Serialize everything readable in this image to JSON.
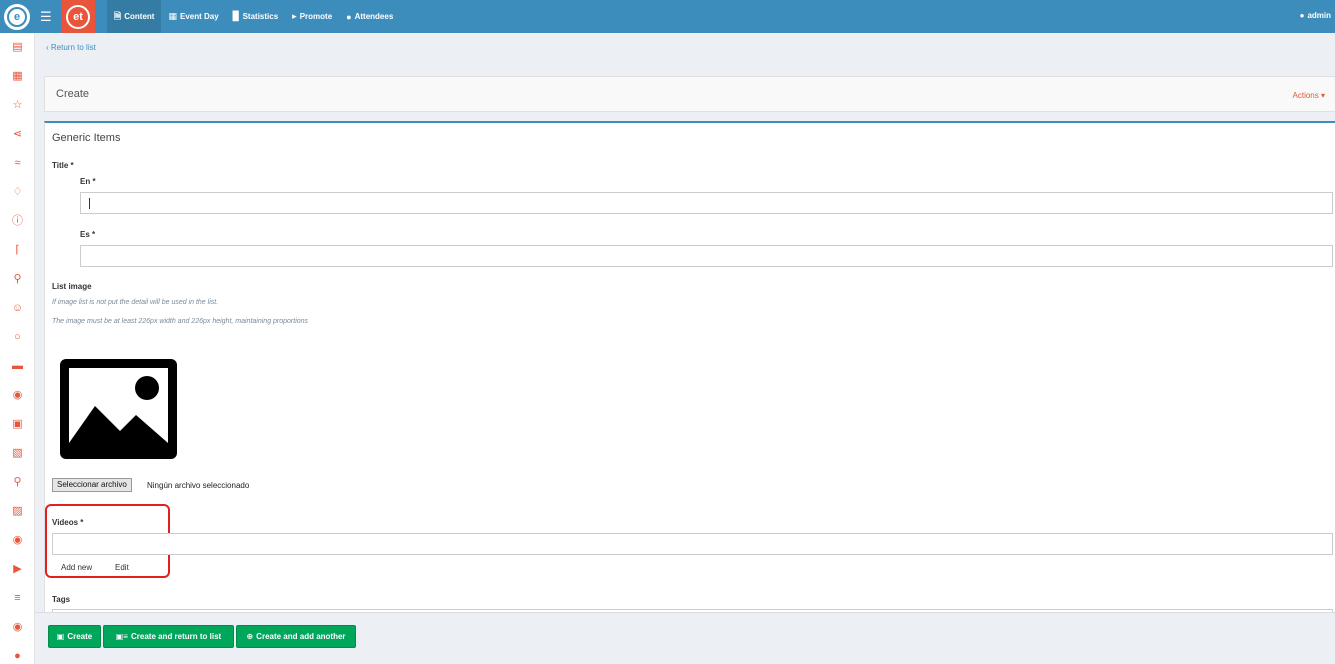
{
  "topbar": {
    "logo_text": "e",
    "brand_text": "et",
    "nav": [
      {
        "label": "Content",
        "icon": "file-icon"
      },
      {
        "label": "Event Day",
        "icon": "calendar-icon"
      },
      {
        "label": "Statistics",
        "icon": "bar-chart-icon"
      },
      {
        "label": "Promote",
        "icon": "megaphone-icon"
      },
      {
        "label": "Attendees",
        "icon": "users-icon"
      }
    ],
    "user": "admin"
  },
  "sidebar_icons": [
    "document-icon",
    "calendar-icon",
    "star-icon",
    "share-icon",
    "handshake-icon",
    "bell-icon",
    "info-icon",
    "microphone-icon",
    "pin-icon",
    "user-icon",
    "chat-icon",
    "cake-icon",
    "location-icon",
    "picture-frame-icon",
    "pages-icon",
    "search-icon",
    "image-icon",
    "camera-icon",
    "video-icon",
    "list-icon",
    "medal-icon",
    "palette-icon"
  ],
  "page": {
    "back_link": "Return to list",
    "header_title": "Create",
    "actions_label": "Actions",
    "section_title": "Generic Items"
  },
  "form": {
    "title_label": "Title *",
    "en_label": "En *",
    "en_value": "",
    "es_label": "Es *",
    "es_value": "",
    "list_image_label": "List image",
    "help_1": "If image list is not put the detail will be used in the list.",
    "help_2": "The image must be at least 226px width and 226px height, maintaining proportions",
    "file_button": "Seleccionar archivo",
    "file_status": "Ningún archivo seleccionado",
    "videos_label": "Videos *",
    "videos_value": "",
    "add_new": "Add new",
    "edit": "Edit",
    "tags_label": "Tags"
  },
  "footer": {
    "create": "Create",
    "create_return": "Create and return to list",
    "create_another": "Create and add another"
  },
  "colors": {
    "primary": "#3c8dbc",
    "accent": "#e8553a",
    "success": "#00a65a",
    "highlight": "#e12020"
  }
}
